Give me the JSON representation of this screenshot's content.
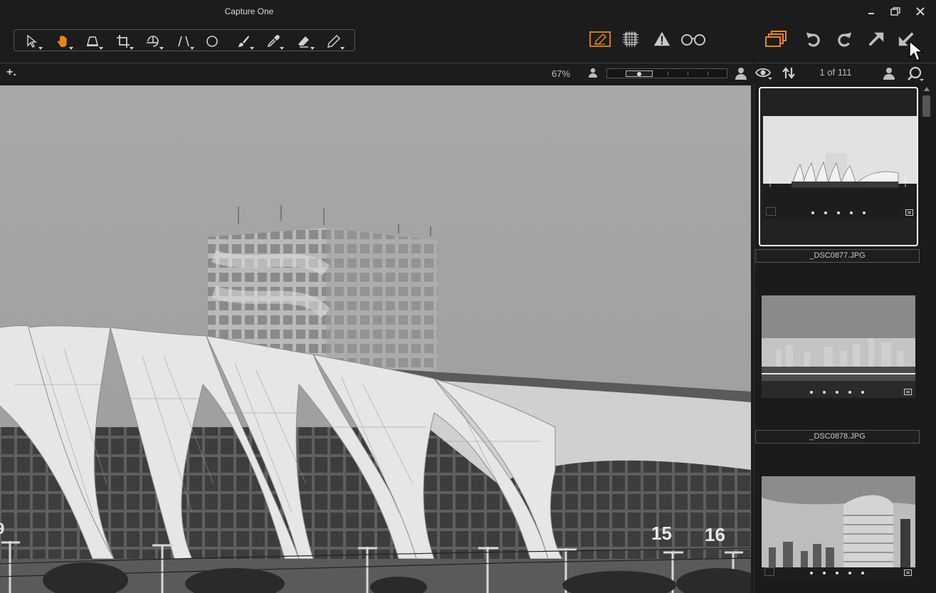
{
  "window": {
    "title": "Capture One",
    "controls": [
      "minimize",
      "restore",
      "close"
    ]
  },
  "toolbar": {
    "tools": [
      {
        "name": "select-tool",
        "icon": "cursor-arrow-icon",
        "active": false
      },
      {
        "name": "pan-tool",
        "icon": "hand-icon",
        "active": true
      },
      {
        "name": "keystone-tool",
        "icon": "keystone-icon",
        "active": false
      },
      {
        "name": "crop-tool",
        "icon": "crop-icon",
        "active": false
      },
      {
        "name": "rotate-tool",
        "icon": "rotate-straighten-icon",
        "active": false
      },
      {
        "name": "perspective-tool",
        "icon": "perspective-lines-icon",
        "active": false
      },
      {
        "name": "spot-removal-tool",
        "icon": "circle-icon",
        "active": false
      },
      {
        "name": "brush-tool",
        "icon": "brush-icon",
        "active": false
      },
      {
        "name": "color-picker-tool",
        "icon": "eyedropper-icon",
        "active": false
      },
      {
        "name": "eraser-tool",
        "icon": "eraser-icon",
        "active": false
      },
      {
        "name": "annotate-tool",
        "icon": "pencil-icon",
        "active": false
      }
    ],
    "view_icons": [
      "edit-overlay-icon",
      "grid-icon",
      "exposure-warning-icon",
      "proof-glasses-icon"
    ],
    "action_icons": [
      "stack-icon",
      "undo-icon",
      "redo-icon",
      "export-icon",
      "import-icon"
    ]
  },
  "viewer": {
    "add_label": "+.",
    "zoom": "67%"
  },
  "browser": {
    "counter": "1 of 111",
    "thumbnails": [
      {
        "filename": "_DSC0877.JPG",
        "selected": true
      },
      {
        "filename": "_DSC0878.JPG",
        "selected": false
      },
      {
        "filename": "",
        "selected": false
      }
    ]
  },
  "photo": {
    "numbers": [
      "15",
      "16"
    ],
    "side_numbers": [
      "9"
    ]
  },
  "colors": {
    "accent": "#e8861e",
    "background": "#1c1c1c",
    "border": "#555555"
  }
}
